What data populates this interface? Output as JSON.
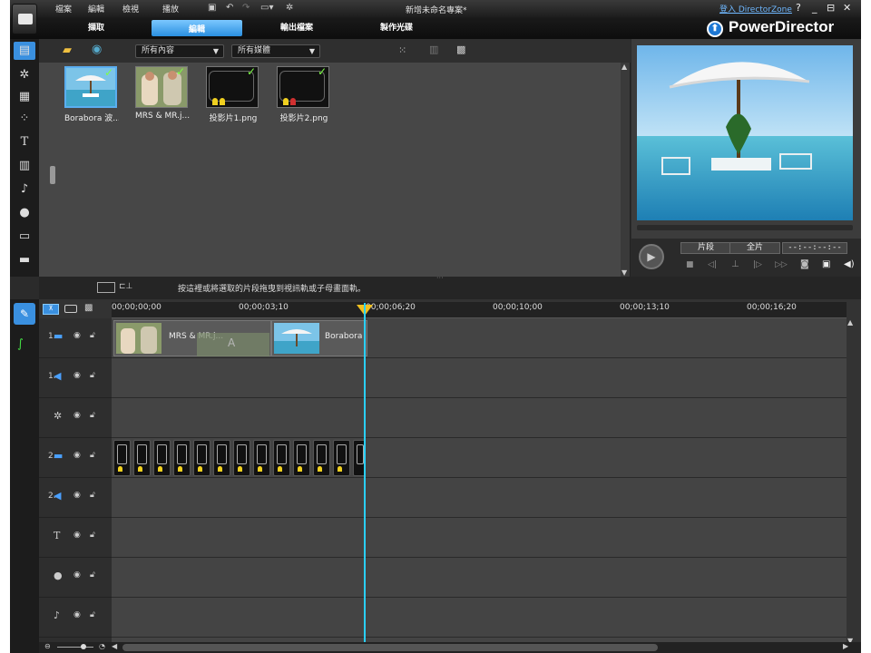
{
  "menu": {
    "file": "檔案",
    "edit": "編輯",
    "view": "檢視",
    "play": "播放"
  },
  "project_title": "新增未命名專案*",
  "login": "登入 DirectorZone",
  "window_controls": {
    "help": "?",
    "minimize": "_",
    "restore": "⊟",
    "close": "✕"
  },
  "modes": {
    "capture": "擷取",
    "edit": "編輯",
    "produce": "輸出檔案",
    "disc": "製作光碟"
  },
  "brand": "PowerDirector",
  "library": {
    "filter_content": "所有內容",
    "filter_media": "所有媒體",
    "items": [
      {
        "caption": "Borabora 波...",
        "selected": true
      },
      {
        "caption": "MRS & MR.j...",
        "selected": false
      },
      {
        "caption": "投影片1.png",
        "selected": false
      },
      {
        "caption": "投影片2.png",
        "selected": false
      }
    ]
  },
  "preview": {
    "clip": "片段",
    "full": "全片",
    "timecode": "--:--:--:--"
  },
  "hint": "按這裡或將選取的片段拖曳到視訊軌或子母畫面軌。",
  "ruler": [
    "00;00;00;00",
    "00;00;03;10",
    "00;00;06;20",
    "00;00;10;00",
    "00;00;13;10",
    "00;00;16;20"
  ],
  "tracks": {
    "video1": {
      "num": "1."
    },
    "audio1": {
      "num": "1."
    },
    "video2": {
      "num": "2."
    },
    "audio2": {
      "num": "2."
    }
  },
  "clips": {
    "mrs": "MRS & MR.j...",
    "borabora": "Borabora",
    "transition": "A"
  },
  "colors": {
    "accent": "#2a8fe0",
    "playhead": "#2ad0ff",
    "check": "#7dff44"
  }
}
